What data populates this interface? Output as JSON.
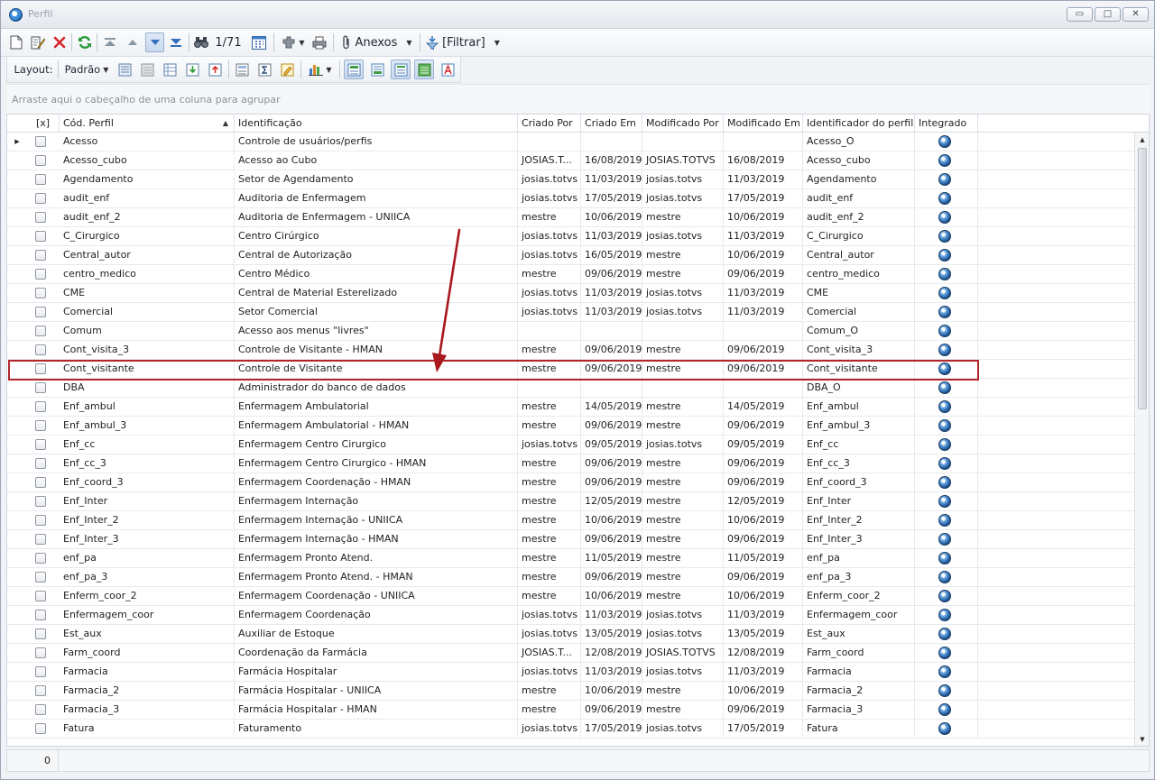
{
  "window": {
    "title": "Perfil",
    "minimize": "▭",
    "maximize": "□",
    "close": "✕"
  },
  "toolbar": {
    "record_counter": "1/71",
    "attachments_label": "Anexos",
    "filter_label": "[Filtrar]"
  },
  "layout_toolbar": {
    "layout_label": "Layout:",
    "layout_value": "Padrão"
  },
  "group_panel": {
    "hint": "Arraste aqui o cabeçalho de uma coluna para agrupar"
  },
  "grid": {
    "columns": [
      "[x]",
      "Cód. Perfil",
      "Identificação",
      "Criado Por",
      "Criado Em",
      "Modificado Por",
      "Modificado Em",
      "Identificador do perfil",
      "Integrado"
    ],
    "rows": [
      [
        "Acesso",
        "Controle de usuários/perfis",
        "",
        "",
        "",
        "",
        "Acesso_O"
      ],
      [
        "Acesso_cubo",
        "Acesso ao Cubo",
        "JOSIAS.T...",
        "16/08/2019",
        "JOSIAS.TOTVS",
        "16/08/2019",
        "Acesso_cubo"
      ],
      [
        "Agendamento",
        "Setor de Agendamento",
        "josias.totvs",
        "11/03/2019",
        "josias.totvs",
        "11/03/2019",
        "Agendamento"
      ],
      [
        "audit_enf",
        "Auditoria de Enfermagem",
        "josias.totvs",
        "17/05/2019",
        "josias.totvs",
        "17/05/2019",
        "audit_enf"
      ],
      [
        "audit_enf_2",
        "Auditoria de Enfermagem  - UNIICA",
        "mestre",
        "10/06/2019",
        "mestre",
        "10/06/2019",
        "audit_enf_2"
      ],
      [
        "C_Cirurgico",
        "Centro Cirúrgico",
        "josias.totvs",
        "11/03/2019",
        "josias.totvs",
        "11/03/2019",
        "C_Cirurgico"
      ],
      [
        "Central_autor",
        "Central de Autorização",
        "josias.totvs",
        "16/05/2019",
        "mestre",
        "10/06/2019",
        "Central_autor"
      ],
      [
        "centro_medico",
        "Centro Médico",
        "mestre",
        "09/06/2019",
        "mestre",
        "09/06/2019",
        "centro_medico"
      ],
      [
        "CME",
        "Central de Material Esterelizado",
        "josias.totvs",
        "11/03/2019",
        "josias.totvs",
        "11/03/2019",
        "CME"
      ],
      [
        "Comercial",
        "Setor Comercial",
        "josias.totvs",
        "11/03/2019",
        "josias.totvs",
        "11/03/2019",
        "Comercial"
      ],
      [
        "Comum",
        "Acesso aos menus \"livres\"",
        "",
        "",
        "",
        "",
        "Comum_O"
      ],
      [
        "Cont_visita_3",
        "Controle de Visitante - HMAN",
        "mestre",
        "09/06/2019",
        "mestre",
        "09/06/2019",
        "Cont_visita_3"
      ],
      [
        "Cont_visitante",
        "Controle de Visitante",
        "mestre",
        "09/06/2019",
        "mestre",
        "09/06/2019",
        "Cont_visitante"
      ],
      [
        "DBA",
        "Administrador do banco de dados",
        "",
        "",
        "",
        "",
        "DBA_O"
      ],
      [
        "Enf_ambul",
        "Enfermagem Ambulatorial",
        "mestre",
        "14/05/2019",
        "mestre",
        "14/05/2019",
        "Enf_ambul"
      ],
      [
        "Enf_ambul_3",
        "Enfermagem Ambulatorial - HMAN",
        "mestre",
        "09/06/2019",
        "mestre",
        "09/06/2019",
        "Enf_ambul_3"
      ],
      [
        "Enf_cc",
        "Enfermagem Centro Cirurgico",
        "josias.totvs",
        "09/05/2019",
        "josias.totvs",
        "09/05/2019",
        "Enf_cc"
      ],
      [
        "Enf_cc_3",
        "Enfermagem Centro Cirurgico - HMAN",
        "mestre",
        "09/06/2019",
        "mestre",
        "09/06/2019",
        "Enf_cc_3"
      ],
      [
        "Enf_coord_3",
        "Enfermagem Coordenação - HMAN",
        "mestre",
        "09/06/2019",
        "mestre",
        "09/06/2019",
        "Enf_coord_3"
      ],
      [
        "Enf_Inter",
        "Enfermagem Internação",
        "mestre",
        "12/05/2019",
        "mestre",
        "12/05/2019",
        "Enf_Inter"
      ],
      [
        "Enf_Inter_2",
        "Enfermagem Internação  - UNIICA",
        "mestre",
        "10/06/2019",
        "mestre",
        "10/06/2019",
        "Enf_Inter_2"
      ],
      [
        "Enf_Inter_3",
        "Enfermagem Internação - HMAN",
        "mestre",
        "09/06/2019",
        "mestre",
        "09/06/2019",
        "Enf_Inter_3"
      ],
      [
        "enf_pa",
        "Enfermagem Pronto Atend.",
        "mestre",
        "11/05/2019",
        "mestre",
        "11/05/2019",
        "enf_pa"
      ],
      [
        "enf_pa_3",
        "Enfermagem Pronto Atend. - HMAN",
        "mestre",
        "09/06/2019",
        "mestre",
        "09/06/2019",
        "enf_pa_3"
      ],
      [
        "Enferm_coor_2",
        "Enfermagem Coordenação  - UNIICA",
        "mestre",
        "10/06/2019",
        "mestre",
        "10/06/2019",
        "Enferm_coor_2"
      ],
      [
        "Enfermagem_coor",
        "Enfermagem Coordenação",
        "josias.totvs",
        "11/03/2019",
        "josias.totvs",
        "11/03/2019",
        "Enfermagem_coor"
      ],
      [
        "Est_aux",
        "Auxiliar de Estoque",
        "josias.totvs",
        "13/05/2019",
        "josias.totvs",
        "13/05/2019",
        "Est_aux"
      ],
      [
        "Farm_coord",
        "Coordenação da Farmácia",
        "JOSIAS.T...",
        "12/08/2019",
        "JOSIAS.TOTVS",
        "12/08/2019",
        "Farm_coord"
      ],
      [
        "Farmacia",
        "Farmácia Hospitalar",
        "josias.totvs",
        "11/03/2019",
        "josias.totvs",
        "11/03/2019",
        "Farmacia"
      ],
      [
        "Farmacia_2",
        "Farmácia Hospitalar  - UNIICA",
        "mestre",
        "10/06/2019",
        "mestre",
        "10/06/2019",
        "Farmacia_2"
      ],
      [
        "Farmacia_3",
        "Farmácia Hospitalar - HMAN",
        "mestre",
        "09/06/2019",
        "mestre",
        "09/06/2019",
        "Farmacia_3"
      ],
      [
        "Fatura",
        "Faturamento",
        "josias.totvs",
        "17/05/2019",
        "josias.totvs",
        "17/05/2019",
        "Fatura"
      ]
    ],
    "highlighted_row": 13,
    "current_row": 0
  },
  "footer": {
    "count": "0"
  },
  "colors": {
    "highlight": "#b2262b",
    "arrow": "#a8181c"
  }
}
